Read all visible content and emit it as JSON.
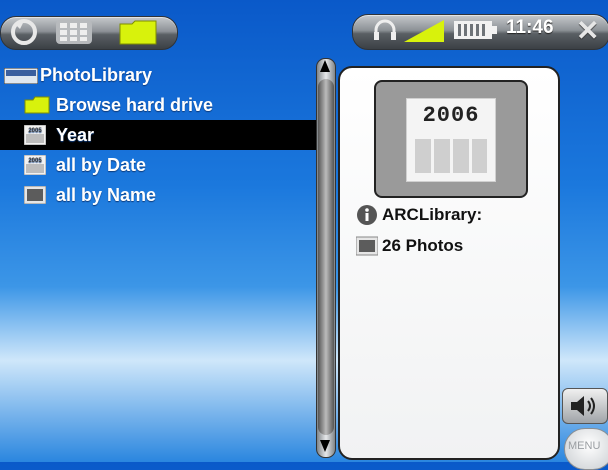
{
  "status_bar": {
    "time": "11:46"
  },
  "colors": {
    "background_blue": "#1b78dd",
    "selection": "#000000",
    "folder_yellow": "#d8f20c"
  },
  "icons": {
    "top_left": [
      "sync-icon",
      "grid-icon",
      "folder-icon"
    ],
    "status": [
      "headphones-icon",
      "signal-icon",
      "battery-icon",
      "close-icon"
    ]
  },
  "list": {
    "title": "PhotoLibrary",
    "items": [
      {
        "label": "Browse hard drive",
        "icon": "folder-icon",
        "selected": false
      },
      {
        "label": "Year",
        "icon": "calendar-icon",
        "selected": true
      },
      {
        "label": "all by Date",
        "icon": "calendar-icon",
        "selected": false
      },
      {
        "label": "all by Name",
        "icon": "photo-icon",
        "selected": false
      }
    ]
  },
  "preview": {
    "year": "2006",
    "library_name": "ARCLibrary:",
    "photo_count": "26 Photos"
  },
  "controls": {
    "menu_label": "MENU"
  }
}
